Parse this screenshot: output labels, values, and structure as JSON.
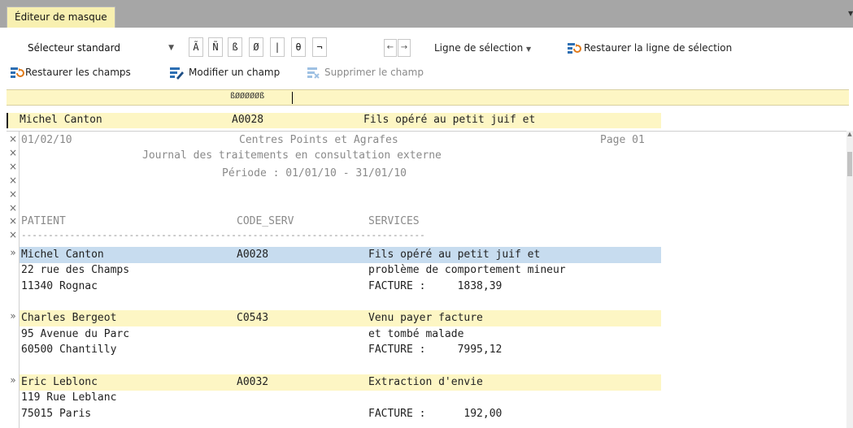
{
  "window": {
    "tab_title": "Éditeur de masque"
  },
  "toolbar": {
    "selector_value": "Sélecteur standard",
    "char_buttons": [
      "Ã",
      "Ñ",
      "ß",
      "Ø",
      "|",
      "θ",
      "¬"
    ],
    "nav_left": "←",
    "nav_right": "→",
    "selection_line_label": "Ligne de sélection",
    "restore_selection_label": "Restaurer la ligne de sélection",
    "restore_fields_label": "Restaurer les champs",
    "modify_field_label": "Modifier un champ",
    "delete_field_label": "Supprimer le champ"
  },
  "ruler": {
    "text": "ßØØØØØß"
  },
  "selection_line": {
    "patient": "Michel Canton",
    "code": "A0028",
    "service": "Fils opéré au petit juif et"
  },
  "header": {
    "date": "01/02/10",
    "org": "Centres Points et Agrafes",
    "page": "Page 01",
    "journal": "Journal des traitements en consultation externe",
    "period": "Période : 01/01/10 - 31/01/10",
    "col_patient": "PATIENT",
    "col_code": "CODE_SERV",
    "col_services": "SERVICES",
    "separator": "---------------------------------------------------------------------------"
  },
  "records": [
    {
      "name": "Michel Canton",
      "code": "A0028",
      "service1": "Fils opéré au petit juif et",
      "address": "22 rue des Champs",
      "service2": "problème de comportement mineur",
      "city": "11340 Rognac",
      "invoice": "FACTURE :     1838,39"
    },
    {
      "name": "Charles Bergeot",
      "code": "C0543",
      "service1": "Venu payer facture",
      "address": "95 Avenue du Parc",
      "service2": "et tombé malade",
      "city": "60500 Chantilly",
      "invoice": "FACTURE :     7995,12"
    },
    {
      "name": "Eric Leblonc",
      "code": "A0032",
      "service1": "Extraction d'envie",
      "address": "119 Rue Leblanc",
      "service2": "",
      "city": "75015 Paris",
      "invoice": "FACTURE :      192,00"
    }
  ],
  "gutter": {
    "ignore_mark": "×",
    "record_mark": "»"
  },
  "colors": {
    "accent_yellow": "#fdf6c4",
    "selection_blue": "#c7dcef",
    "titlebar_gray": "#a6a6a6"
  }
}
